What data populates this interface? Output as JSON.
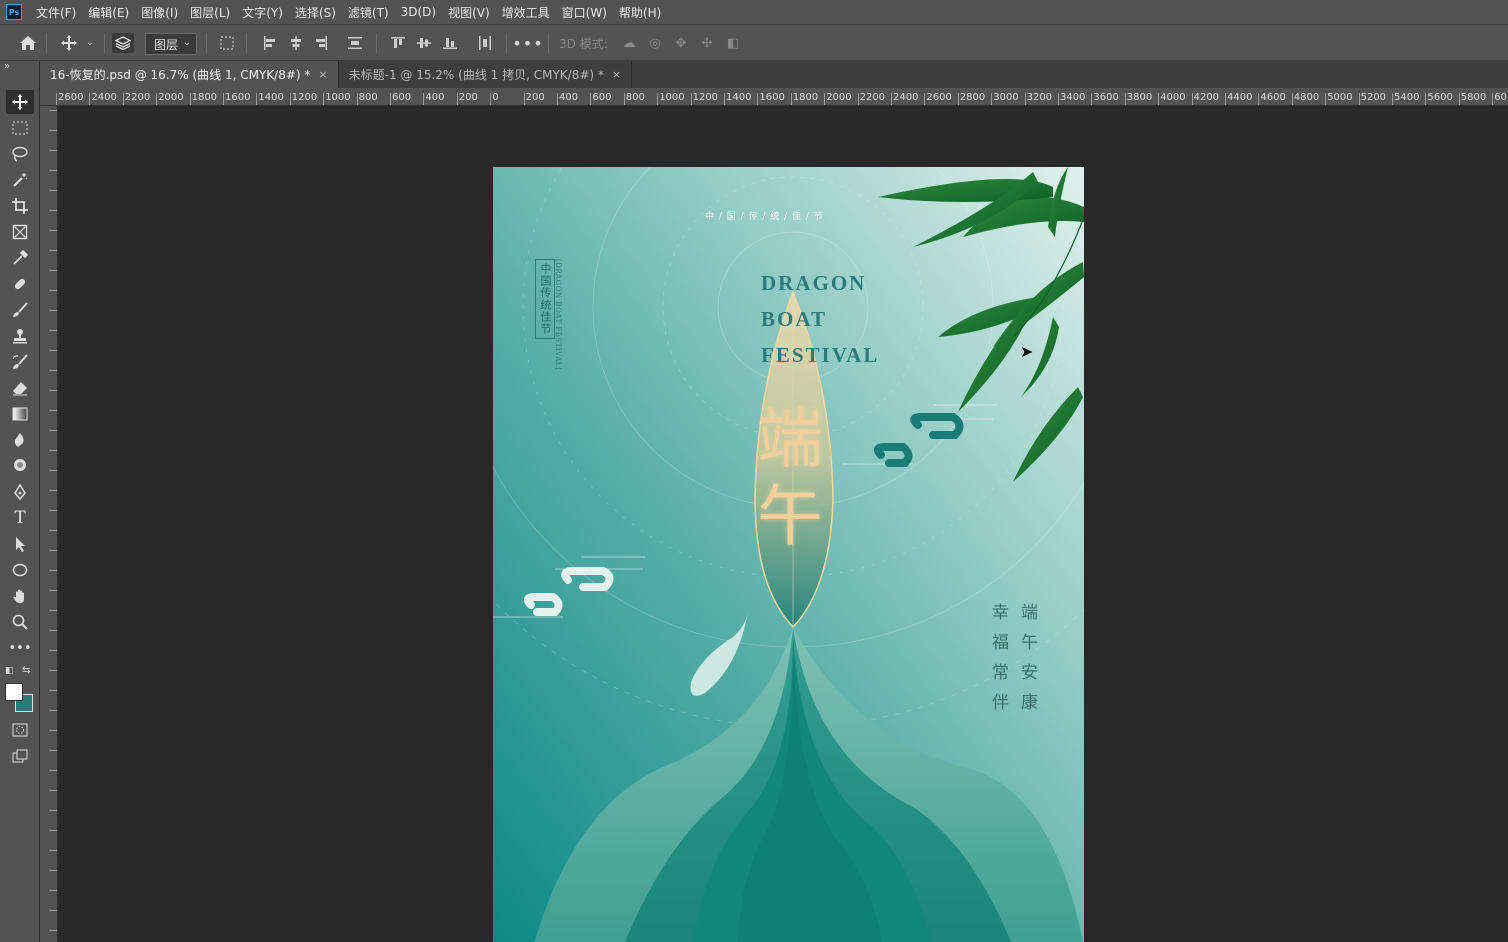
{
  "menubar": {
    "logo": "Ps",
    "items": [
      "文件(F)",
      "编辑(E)",
      "图像(I)",
      "图层(L)",
      "文字(Y)",
      "选择(S)",
      "滤镜(T)",
      "3D(D)",
      "视图(V)",
      "增效工具",
      "窗口(W)",
      "帮助(H)"
    ]
  },
  "options": {
    "layer_select": "图层",
    "mode_3d": "3D 模式:"
  },
  "tabs": [
    {
      "label": "16-恢复的.psd @ 16.7% (曲线 1, CMYK/8#) *",
      "close": "×"
    },
    {
      "label": "未标题-1 @ 15.2% (曲线 1 拷贝, CMYK/8#) *",
      "close": "×"
    }
  ],
  "ruler": {
    "top_labels": [
      "2600",
      "2400",
      "2200",
      "2000",
      "1800",
      "1600",
      "1400",
      "1200",
      "1000",
      "800",
      "600",
      "400",
      "200",
      "0",
      "200",
      "400",
      "600",
      "800",
      "1000",
      "1200",
      "1400",
      "1600",
      "1800",
      "2000",
      "2200",
      "2400",
      "2600",
      "2800",
      "3000",
      "3200",
      "3400",
      "3600",
      "3800",
      "4000",
      "4200",
      "4400",
      "4600",
      "4800",
      "5000",
      "5200",
      "5400",
      "5600",
      "5800",
      "60"
    ]
  },
  "poster": {
    "top_line": "中 / 国 / 传 / 统 / 佳 / 节",
    "stamp_cn": "中国传统佳节",
    "stamp_en": "[DRAGON BOAT FESTIVAL]",
    "title_en_1": "DRAGON",
    "title_en_2": "BOAT",
    "title_en_3": "FESTIVAL",
    "title_cn_1": "端",
    "title_cn_2": "午",
    "blessing_col1": "端午安康",
    "blessing_col2": "幸福常伴",
    "colors": {
      "teal_dark": "#0e8a88",
      "teal_light": "#d5ebe6",
      "gold": "#e8c28a",
      "text_teal": "#2b7c78"
    }
  }
}
